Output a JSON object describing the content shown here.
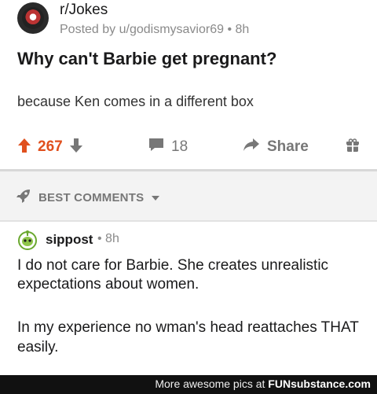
{
  "post": {
    "subreddit": "r/Jokes",
    "posted_by": "Posted by u/godismysavior69 • 8h",
    "title": "Why can't Barbie get pregnant?",
    "body": "because Ken comes in a different box",
    "score": "267",
    "comment_count": "18",
    "share_label": "Share"
  },
  "sort": {
    "label": "BEST COMMENTS"
  },
  "comment": {
    "username": "sippost",
    "time": "• 8h",
    "paragraph1": "I do not care for Barbie. She creates unrealistic expectations about women.",
    "paragraph2": "In my experience no wman's head reattaches THAT easily."
  },
  "footer": {
    "prefix": "More awesome pics at ",
    "brand": "FUNsubstance.com"
  },
  "colors": {
    "upvote": "#e0501e",
    "muted": "#777777",
    "sort_bg": "#f3f3f3"
  }
}
